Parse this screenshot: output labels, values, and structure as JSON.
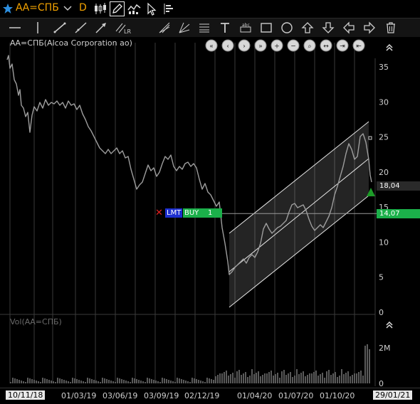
{
  "toolbar": {
    "ticker": "АА=СПБ",
    "interval": "D"
  },
  "chart": {
    "title": "АА=СПБ(Alcoa Corporation ао)",
    "volume_title": "Vol(АА=СПБ)",
    "y_ticks": [
      "35",
      "30",
      "25",
      "20",
      "15",
      "10",
      "5",
      "0"
    ],
    "volume_ticks": [
      "2M",
      "0"
    ],
    "last_price": "18,04",
    "order_price": "14,07",
    "order": {
      "type": "LMT",
      "side": "BUY",
      "quantity": "1",
      "cancel_glyph": "✕"
    },
    "colors": {
      "last_price_tag": "#2a2a2a",
      "order_line": "#1bb04a",
      "order_type_bg": "#1d2fd0",
      "up_arrow": "#1d9b28",
      "cancel_x": "#e02020"
    }
  },
  "date_axis": {
    "start": "10/11/18",
    "labels": [
      "01/03/19",
      "03/06/19",
      "03/09/19",
      "02/12/19",
      "01/04/20",
      "01/07/20",
      "01/10/20"
    ],
    "end": "29/01/21"
  },
  "icons": {
    "top": [
      "star-icon",
      "chevron-down-icon",
      "candles-icon",
      "pencil-icon",
      "dual-chart-icon",
      "cursor-icon",
      "order-book-icon"
    ],
    "draw": [
      "horizontal-line-icon",
      "vertical-line-icon",
      "trend-line-icon",
      "ray-icon",
      "arrow-line-icon",
      "linear-regression-icon",
      "fibonacci-fan-icon",
      "gann-fan-icon",
      "fibonacci-levels-icon",
      "text-icon",
      "label-icon",
      "rectangle-icon",
      "ellipse-icon",
      "arrow-up-icon",
      "arrow-down-icon",
      "arrow-left-icon",
      "arrow-right-icon",
      "trash-icon"
    ],
    "nav": [
      "first-icon",
      "prev-icon",
      "next-icon",
      "last-icon",
      "zoom-in-icon",
      "zoom-out-icon",
      "search-icon",
      "expand-icon",
      "shrink-icon",
      "fit-icon",
      "end-icon",
      "collapse-icon"
    ]
  }
}
